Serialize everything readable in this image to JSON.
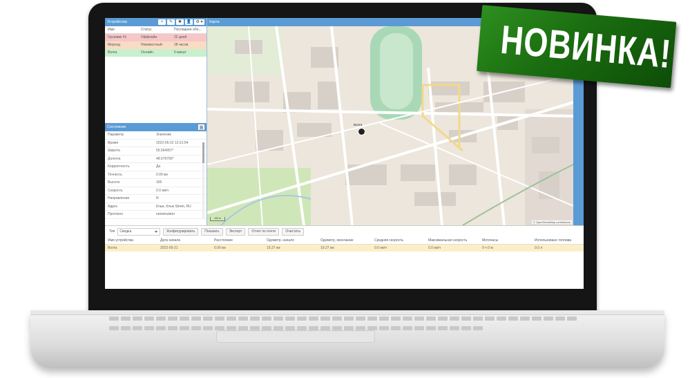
{
  "badge": {
    "text": "НОВИНКА!"
  },
  "devices_panel": {
    "title": "Устройства",
    "toolbar": [
      "+",
      "✎",
      "✖",
      "👤",
      "⚙ ▾"
    ],
    "columns": [
      "Имя",
      "Статус",
      "Последнее обн..."
    ],
    "rows": [
      {
        "name": "Грузовик #1",
        "status": "Оффлайн",
        "updated": "22 дней",
        "color": "#f7c6c6"
      },
      {
        "name": "Мерсед",
        "status": "Неизвестный",
        "updated": "28 часов",
        "color": "#f8dcc3"
      },
      {
        "name": "Волга",
        "status": "Онлайн",
        "updated": "5 минут",
        "color": "#c8f0cc"
      }
    ]
  },
  "state_panel": {
    "title": "Состояние",
    "columns": [
      "Параметр",
      "Значение"
    ],
    "rows": [
      {
        "key": "Время",
        "value": "2022-05-22 12:31:54"
      },
      {
        "key": "Широта",
        "value": "55.564957°"
      },
      {
        "key": "Долгота",
        "value": "48.679760°"
      },
      {
        "key": "Корректность",
        "value": "Да"
      },
      {
        "key": "Точность",
        "value": "0.00 км"
      },
      {
        "key": "Высота",
        "value": "165"
      },
      {
        "key": "Скорость",
        "value": "0.0 км/ч"
      },
      {
        "key": "Направление",
        "value": "N"
      },
      {
        "key": "Адрес",
        "value": "Клык, Клык Street, RU"
      },
      {
        "key": "Протокол",
        "value": "netsimulator"
      }
    ]
  },
  "map_panel": {
    "title": "Карта",
    "marker_label": "Волга",
    "attribution": "© OpenStreetMap contributors",
    "scale": "100 m"
  },
  "report_panel": {
    "type_label": "Тип",
    "type_value": "Сводка",
    "buttons": [
      "Конфигурировать",
      "Показать",
      "Экспорт",
      "Отчет по почте",
      "Очистить"
    ],
    "columns": [
      "Имя устройства",
      "Дата начала",
      "Расстояние",
      "Одометр, начало",
      "Одометр, окончание",
      "Средняя скорость",
      "Максимальная скорость",
      "Моточасы",
      "Использовано топлива"
    ],
    "row": [
      "Волга",
      "2022-05-21",
      "0.00 км",
      "19.27 км",
      "19.27 км",
      "0.0 км/ч",
      "0.0 км/ч",
      "0 ч 0 м",
      "0.0 л"
    ]
  }
}
